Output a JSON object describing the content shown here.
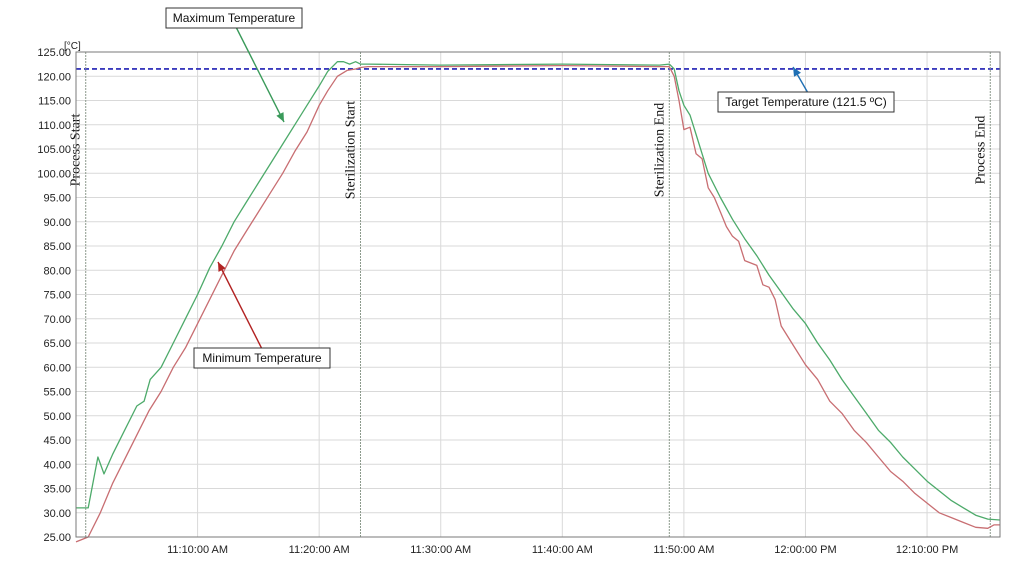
{
  "chart_data": {
    "type": "line",
    "title": "",
    "xlabel": "",
    "ylabel": "[°C]",
    "ylim": [
      25,
      125
    ],
    "y_ticks": [
      "25.00",
      "30.00",
      "35.00",
      "40.00",
      "45.00",
      "50.00",
      "55.00",
      "60.00",
      "65.00",
      "70.00",
      "75.00",
      "80.00",
      "85.00",
      "90.00",
      "95.00",
      "100.00",
      "105.00",
      "110.00",
      "115.00",
      "120.00",
      "125.00"
    ],
    "x_range_minutes": [
      600,
      676
    ],
    "x_ticks": [
      {
        "t": 610,
        "label": "11:10:00 AM"
      },
      {
        "t": 620,
        "label": "11:20:00 AM"
      },
      {
        "t": 630,
        "label": "11:30:00 AM"
      },
      {
        "t": 640,
        "label": "11:40:00 AM"
      },
      {
        "t": 650,
        "label": "11:50:00 AM"
      },
      {
        "t": 660,
        "label": "12:00:00 PM"
      },
      {
        "t": 670,
        "label": "12:10:00 PM"
      }
    ],
    "grid": true,
    "target": {
      "value": 121.5,
      "label": "Target Temperature (121.5 ºC)",
      "color": "#1f1fb4"
    },
    "events": [
      {
        "t": 600.8,
        "label": "Process Start"
      },
      {
        "t": 623.4,
        "label": "Sterilization Start"
      },
      {
        "t": 648.8,
        "label": "Sterilization End"
      },
      {
        "t": 675.2,
        "label": "Process End"
      }
    ],
    "series": [
      {
        "name": "Maximum Temperature",
        "color": "#4daa6a",
        "x": [
          600,
          601,
          601.8,
          602.3,
          603,
          604,
          605,
          605.6,
          606.1,
          607,
          608,
          609,
          610,
          611,
          612,
          613,
          614,
          615,
          616,
          617,
          618,
          619,
          620,
          620.7,
          621.5,
          622,
          622.5,
          623,
          623.4,
          624,
          630,
          640,
          648,
          648.8,
          649.2,
          649.6,
          650,
          650.5,
          651,
          651.5,
          652,
          653,
          654,
          655,
          656,
          657,
          658,
          659,
          660,
          661,
          662,
          663,
          664,
          665,
          666,
          667,
          668,
          669,
          670,
          671,
          672,
          673,
          674,
          675,
          676
        ],
        "y": [
          31,
          31,
          41.5,
          38,
          42,
          47,
          52,
          53,
          57.5,
          60,
          65,
          70,
          75,
          80.5,
          85,
          90,
          94,
          98,
          102,
          106,
          110,
          114,
          118,
          121,
          123,
          123,
          122.5,
          123,
          122.5,
          122.5,
          122.3,
          122.5,
          122.3,
          122.5,
          121.5,
          117,
          114,
          112,
          108,
          104,
          100,
          95,
          90.5,
          86.5,
          83,
          79,
          75.5,
          72,
          69,
          65,
          61.5,
          57.5,
          54,
          50.5,
          47,
          44.5,
          41.5,
          39,
          36.5,
          34.5,
          32.5,
          31,
          29.5,
          28.7,
          28.5
        ]
      },
      {
        "name": "Minimum Temperature",
        "color": "#c86e72",
        "x": [
          600,
          601,
          602,
          603,
          604,
          605,
          606,
          607,
          608,
          609,
          610,
          611,
          612,
          613,
          614,
          615,
          616,
          617,
          618,
          619,
          620,
          620.7,
          621.5,
          622.3,
          623,
          623.4,
          624,
          630,
          640,
          648,
          648.8,
          649.2,
          649.6,
          650,
          650.5,
          651,
          651.5,
          652,
          652.5,
          653,
          653.5,
          654,
          654.5,
          655,
          655.5,
          656,
          656.5,
          657,
          657.5,
          658,
          659,
          660,
          661,
          662,
          663,
          664,
          665,
          666,
          667,
          668,
          669,
          670,
          671,
          672,
          673,
          674,
          675,
          675.5,
          676
        ],
        "y": [
          24,
          25,
          30,
          36,
          41,
          46,
          51,
          55,
          60,
          64,
          69,
          74,
          79,
          84,
          88,
          92,
          96,
          100,
          104.5,
          108.5,
          114,
          117,
          120,
          121.2,
          121.5,
          121.8,
          122,
          122,
          122.2,
          122,
          122,
          120,
          115,
          109,
          109.5,
          104,
          103,
          97,
          95,
          92,
          89,
          87,
          86,
          82,
          81.5,
          81,
          77,
          76.5,
          74,
          68.5,
          64.5,
          60.5,
          57.5,
          53,
          50.5,
          47,
          44.5,
          41.5,
          38.5,
          36.5,
          34,
          32,
          30,
          29,
          28,
          27,
          26.8,
          27.5,
          27.5
        ]
      }
    ],
    "callouts": [
      {
        "label": "Maximum Temperature",
        "series": 0
      },
      {
        "label": "Minimum Temperature",
        "series": 1
      }
    ]
  }
}
